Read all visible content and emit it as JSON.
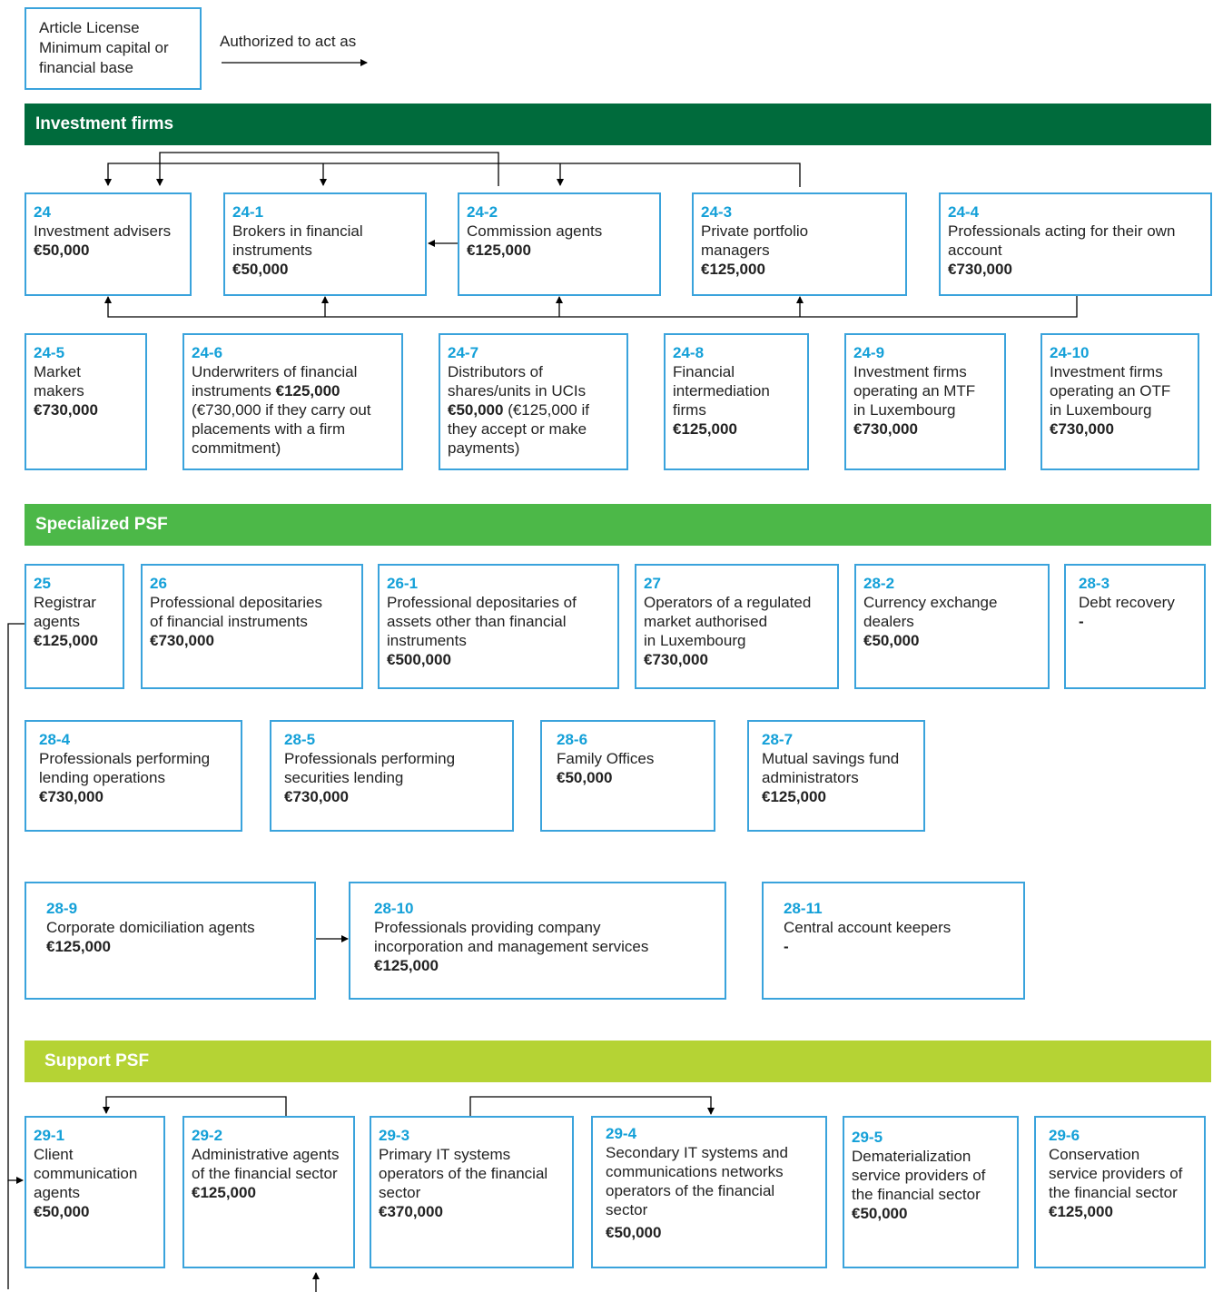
{
  "legend": {
    "box_text": "Article License\nMinimum capital or\nfinancial base",
    "arrow_label": "Authorized to act as"
  },
  "sections": {
    "investment_firms": "Investment firms",
    "specialized_psf": "Specialized PSF",
    "support_psf": "Support PSF"
  },
  "colors": {
    "investment": "#006b3c",
    "specialized": "#4cb848",
    "support": "#b5d334",
    "box_border": "#3aa3dc",
    "code": "#14a0d8"
  },
  "boxes": {
    "b24": {
      "code": "24",
      "name": "Investment advisers",
      "cap": "€50,000"
    },
    "b24_1": {
      "code": "24-1",
      "name": "Brokers in financial\ninstruments",
      "cap": "€50,000"
    },
    "b24_2": {
      "code": "24-2",
      "name": "Commission agents",
      "cap": "€125,000"
    },
    "b24_3": {
      "code": "24-3",
      "name": "Private portfolio\nmanagers",
      "cap": "€125,000"
    },
    "b24_4": {
      "code": "24-4",
      "name": "Professionals acting for their own\naccount",
      "cap": "€730,000"
    },
    "b24_5": {
      "code": "24-5",
      "name": "Market\nmakers",
      "cap": "€730,000"
    },
    "b24_6": {
      "code": "24-6",
      "name": "Underwriters of financial\ninstruments",
      "cap": "€125,000",
      "note": "(€730,000 if they carry out\nplacements with a firm\ncommitment)"
    },
    "b24_7": {
      "code": "24-7",
      "name": "Distributors of\nshares/units in  UCIs",
      "cap": "€50,000",
      "note": "(€125,000 if\nthey accept or make\npayments)"
    },
    "b24_8": {
      "code": "24-8",
      "name": "Financial\nintermediation\nfirms",
      "cap": "€125,000"
    },
    "b24_9": {
      "code": "24-9",
      "name": "Investment firms\noperating an MTF\nin Luxembourg",
      "cap": "€730,000"
    },
    "b24_10": {
      "code": "24-10",
      "name": "Investment firms\noperating an OTF\nin Luxembourg",
      "cap": "€730,000"
    },
    "b25": {
      "code": "25",
      "name": "Registrar\nagents",
      "cap": "€125,000"
    },
    "b26": {
      "code": "26",
      "name": "Professional depositaries\nof financial instruments",
      "cap": "€730,000"
    },
    "b26_1": {
      "code": "26-1",
      "name": "Professional depositaries of\nassets other than financial\ninstruments",
      "cap": "€500,000"
    },
    "b27": {
      "code": "27",
      "name": "Operators of a regulated\nmarket authorised\nin Luxembourg",
      "cap": "€730,000"
    },
    "b28_2": {
      "code": "28-2",
      "name": "Currency exchange\ndealers",
      "cap": "€50,000"
    },
    "b28_3": {
      "code": "28-3",
      "name": "Debt recovery",
      "cap": "-"
    },
    "b28_4": {
      "code": "28-4",
      "name": "Professionals performing\nlending operations",
      "cap": "€730,000"
    },
    "b28_5": {
      "code": "28-5",
      "name": "Professionals performing\nsecurities lending",
      "cap": "€730,000"
    },
    "b28_6": {
      "code": "28-6",
      "name": "Family Offices",
      "cap": "€50,000"
    },
    "b28_7": {
      "code": "28-7",
      "name": "Mutual savings fund\nadministrators",
      "cap": "€125,000"
    },
    "b28_9": {
      "code": "28-9",
      "name": "Corporate domiciliation agents",
      "cap": "€125,000"
    },
    "b28_10": {
      "code": "28-10",
      "name": "Professionals providing company\nincorporation and management services",
      "cap": "€125,000"
    },
    "b28_11": {
      "code": "28-11",
      "name": "Central account keepers",
      "cap": "-"
    },
    "b29_1": {
      "code": "29-1",
      "name": "Client\ncommunication\nagents",
      "cap": "€50,000"
    },
    "b29_2": {
      "code": "29-2",
      "name": "Administrative agents\nof the financial sector",
      "cap": "€125,000"
    },
    "b29_3": {
      "code": "29-3",
      "name": "Primary IT systems\noperators of the financial\nsector",
      "cap": "€370,000"
    },
    "b29_4": {
      "code": "29-4",
      "name": "Secondary IT systems and\ncommunications networks\noperators of the financial\nsector",
      "cap": "€50,000"
    },
    "b29_5": {
      "code": "29-5",
      "name": "Dematerialization\nservice providers of\nthe financial sector",
      "cap": "€50,000"
    },
    "b29_6": {
      "code": "29-6",
      "name": "Conservation\nservice providers of\nthe financial sector",
      "cap": "€125,000"
    }
  }
}
